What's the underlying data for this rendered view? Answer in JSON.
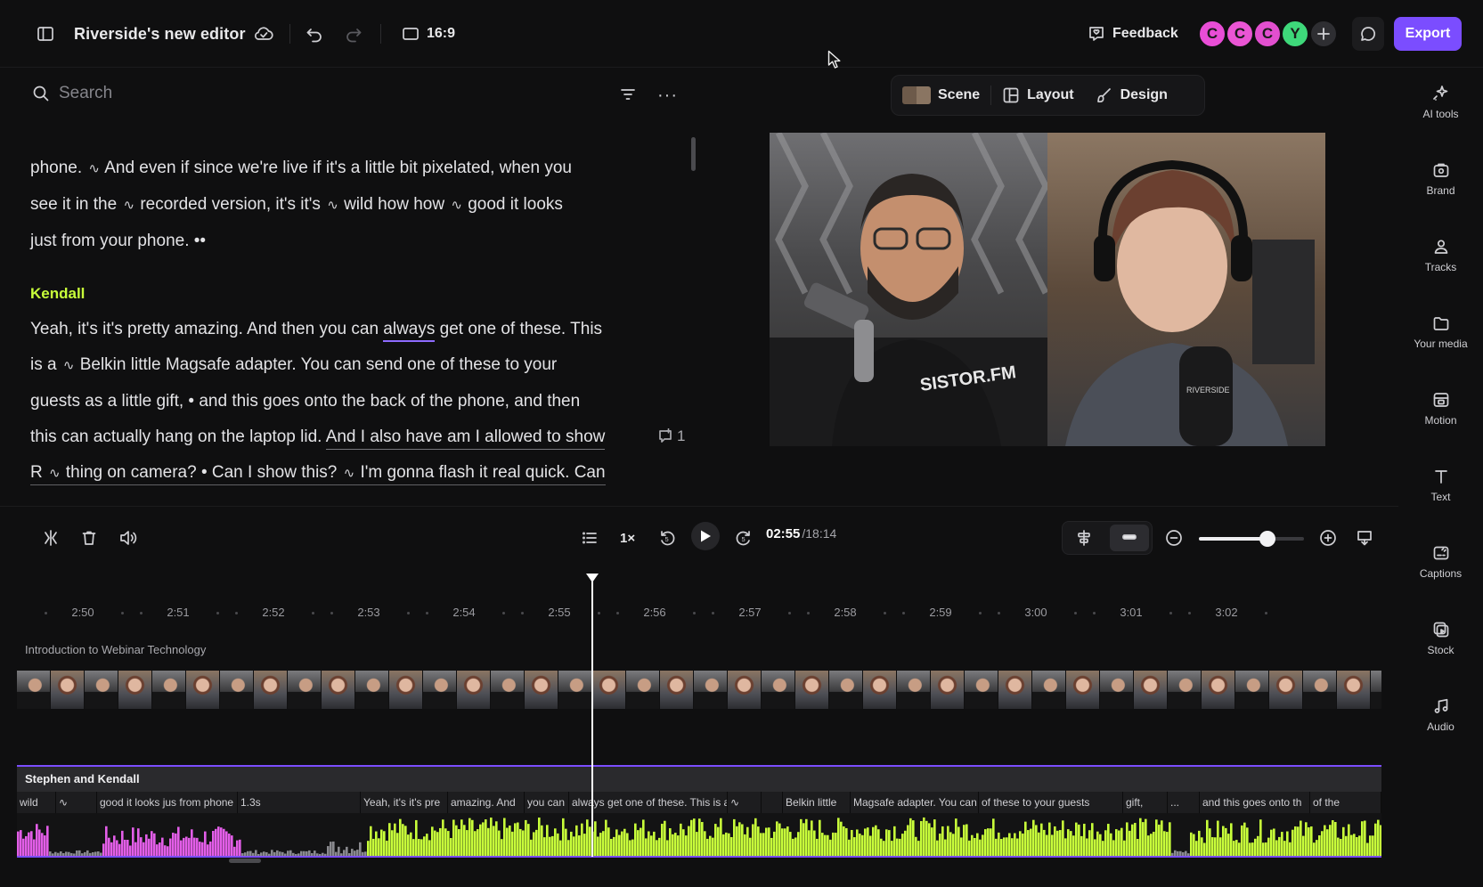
{
  "topbar": {
    "title": "Riverside's new editor",
    "aspect": "16:9",
    "feedback_label": "Feedback",
    "export_label": "Export",
    "collaborators": [
      {
        "initial": "C",
        "color": "#e84dd6"
      },
      {
        "initial": "C",
        "color": "#ea55d4"
      },
      {
        "initial": "C",
        "color": "#e24fcf"
      },
      {
        "initial": "Y",
        "color": "#3ed87a"
      }
    ]
  },
  "transcript": {
    "search_placeholder": "Search",
    "p1": {
      "line1a": "phone.",
      "line1b": "And even if since we're live if it's a little bit pixelated, when you",
      "line2a": "see it in the",
      "line2b": "recorded version, it's it's",
      "line2c": "wild how how",
      "line2d": "good it looks",
      "line3": "just from your phone. ••"
    },
    "speaker": "Kendall",
    "p2": {
      "l1a": "Yeah, it's it's pretty amazing. And then you can",
      "l1b": "always",
      "l1c": "get one of these. This",
      "l2a": "is a",
      "l2b": "Belkin little Magsafe adapter. You can send one of these to your",
      "l3": "guests as a little gift, • and this goes onto the back of the phone, and then",
      "l4a": "this can actually hang on the laptop lid.",
      "l4b": "And I also have am I allowed to show",
      "l5a": "R",
      "l5b": "thing on camera? • Can I show this?",
      "l5c": "I'm gonna flash it real quick. Can",
      "comment_count": "1"
    }
  },
  "scene_bar": {
    "scene": "Scene",
    "layout": "Layout",
    "design": "Design"
  },
  "right_rail": [
    {
      "label": "AI tools",
      "icon": "sparkle-icon"
    },
    {
      "label": "Brand",
      "icon": "brand-icon"
    },
    {
      "label": "Tracks",
      "icon": "tracks-icon"
    },
    {
      "label": "Your media",
      "icon": "folder-icon"
    },
    {
      "label": "Motion",
      "icon": "motion-icon"
    },
    {
      "label": "Text",
      "icon": "text-icon"
    },
    {
      "label": "Captions",
      "icon": "captions-icon"
    },
    {
      "label": "Stock",
      "icon": "stock-icon"
    },
    {
      "label": "Audio",
      "icon": "music-icon"
    }
  ],
  "controls": {
    "speed": "1×",
    "time_current": "02:55",
    "time_total": "/18:14",
    "zoom_level": 0.65
  },
  "timeline": {
    "ticks": [
      "2:50",
      "2:51",
      "2:52",
      "2:53",
      "2:54",
      "2:55",
      "2:56",
      "2:57",
      "2:58",
      "2:59",
      "3:00",
      "3:01",
      "3:02"
    ],
    "video_track_label": "Introduction to Webinar Technology",
    "audio_track_label": "Stephen and Kendall",
    "words": [
      {
        "text": "wild",
        "w": 44
      },
      {
        "text": "∿",
        "w": 46
      },
      {
        "text": "good it looks jus from phone",
        "w": 158
      },
      {
        "text": "1.3s",
        "w": 138
      },
      {
        "text": "Yeah, it's it's pre",
        "w": 98
      },
      {
        "text": "amazing. And",
        "w": 86
      },
      {
        "text": "you can",
        "w": 50
      },
      {
        "text": "always get one of these. This is a",
        "w": 178
      },
      {
        "text": "∿",
        "w": 38
      },
      {
        "text": "",
        "w": 24
      },
      {
        "text": "Belkin little",
        "w": 76
      },
      {
        "text": "Magsafe adapter. You can se",
        "w": 144
      },
      {
        "text": "of these to your guests",
        "w": 162
      },
      {
        "text": "gift,",
        "w": 50
      },
      {
        "text": "...",
        "w": 36
      },
      {
        "text": "and this goes onto th",
        "w": 124
      },
      {
        "text": "of the",
        "w": 80
      }
    ],
    "colors": {
      "speaker_a": "#e35ee8",
      "speaker_b": "#c8ff3a",
      "silence": "#8a8a8f"
    }
  }
}
